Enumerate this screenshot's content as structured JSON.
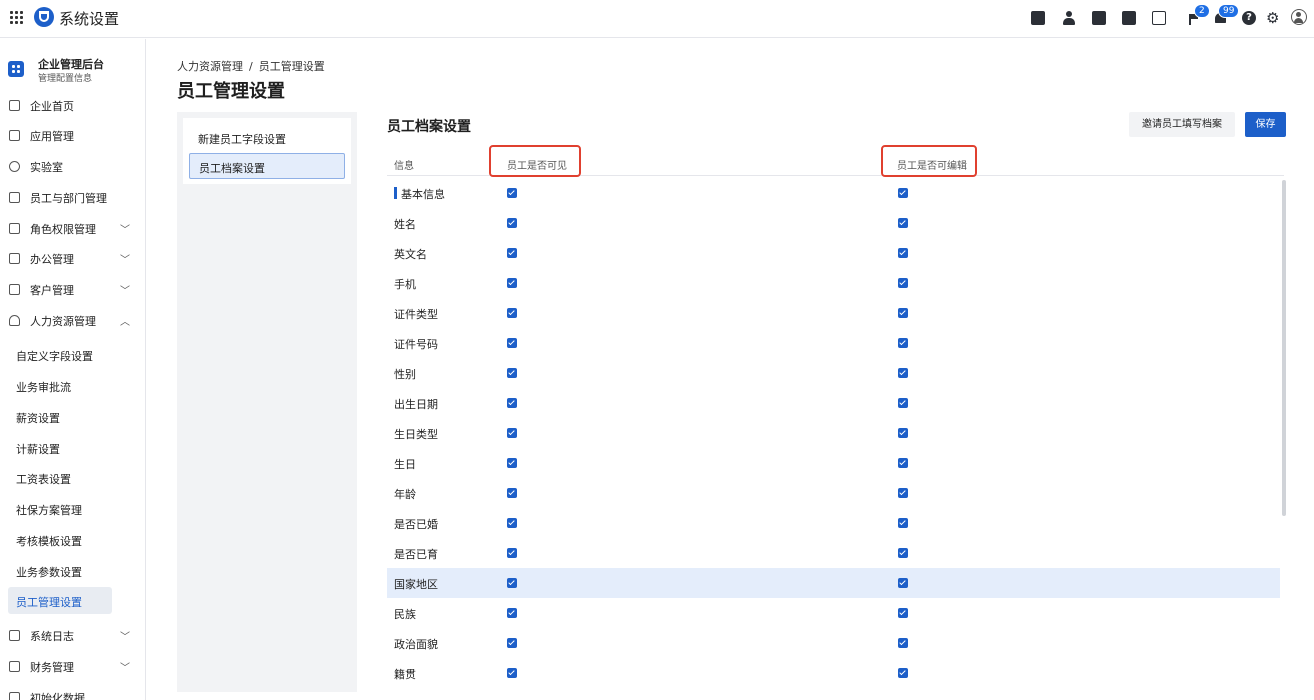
{
  "app": {
    "title": "系统设置"
  },
  "topbar": {
    "flag_badge": "2",
    "bell_badge": "99"
  },
  "sidebar": {
    "enterprise_title": "企业管理后台",
    "enterprise_sub": "管理配置信息",
    "nav": [
      {
        "label": "企业首页"
      },
      {
        "label": "应用管理"
      },
      {
        "label": "实验室"
      },
      {
        "label": "员工与部门管理"
      },
      {
        "label": "角色权限管理",
        "expandable": true
      },
      {
        "label": "办公管理",
        "expandable": true
      },
      {
        "label": "客户管理",
        "expandable": true
      },
      {
        "label": "人力资源管理",
        "expandable": true,
        "expanded": true
      }
    ],
    "sub_items": [
      {
        "label": "自定义字段设置"
      },
      {
        "label": "业务审批流"
      },
      {
        "label": "薪资设置"
      },
      {
        "label": "计薪设置"
      },
      {
        "label": "工资表设置"
      },
      {
        "label": "社保方案管理"
      },
      {
        "label": "考核模板设置"
      },
      {
        "label": "业务参数设置"
      },
      {
        "label": "员工管理设置",
        "active": true
      }
    ],
    "nav_bottom": [
      {
        "label": "系统日志",
        "expandable": true
      },
      {
        "label": "财务管理",
        "expandable": true
      },
      {
        "label": "初始化数据"
      }
    ]
  },
  "breadcrumb": [
    "人力资源管理",
    "/",
    "员工管理设置"
  ],
  "page_title": "员工管理设置",
  "left_menu": {
    "item1": "新建员工字段设置",
    "item2": "员工档案设置"
  },
  "section": {
    "title": "员工档案设置",
    "invite_button": "邀请员工填写档案",
    "save_button": "保存"
  },
  "table": {
    "headers": [
      "信息",
      "员工是否可见",
      "员工是否可编辑"
    ],
    "rows": [
      {
        "name": "基本信息",
        "group": true,
        "visible": true,
        "editable": true
      },
      {
        "name": "姓名",
        "visible": true,
        "editable": true
      },
      {
        "name": "英文名",
        "visible": true,
        "editable": true
      },
      {
        "name": "手机",
        "visible": true,
        "editable": true
      },
      {
        "name": "证件类型",
        "visible": true,
        "editable": true
      },
      {
        "name": "证件号码",
        "visible": true,
        "editable": true
      },
      {
        "name": "性别",
        "visible": true,
        "editable": true
      },
      {
        "name": "出生日期",
        "visible": true,
        "editable": true
      },
      {
        "name": "生日类型",
        "visible": true,
        "editable": true
      },
      {
        "name": "生日",
        "visible": true,
        "editable": true
      },
      {
        "name": "年龄",
        "visible": true,
        "editable": true
      },
      {
        "name": "是否已婚",
        "visible": true,
        "editable": true
      },
      {
        "name": "是否已育",
        "visible": true,
        "editable": true
      },
      {
        "name": "国家地区",
        "visible": true,
        "editable": true,
        "highlighted": true
      },
      {
        "name": "民族",
        "visible": true,
        "editable": true
      },
      {
        "name": "政治面貌",
        "visible": true,
        "editable": true
      },
      {
        "name": "籍贯",
        "visible": true,
        "editable": true
      }
    ]
  },
  "colors": {
    "accent": "#1d5fc9",
    "annotation": "#e0402f",
    "row_highlight": "#e4edfb"
  }
}
